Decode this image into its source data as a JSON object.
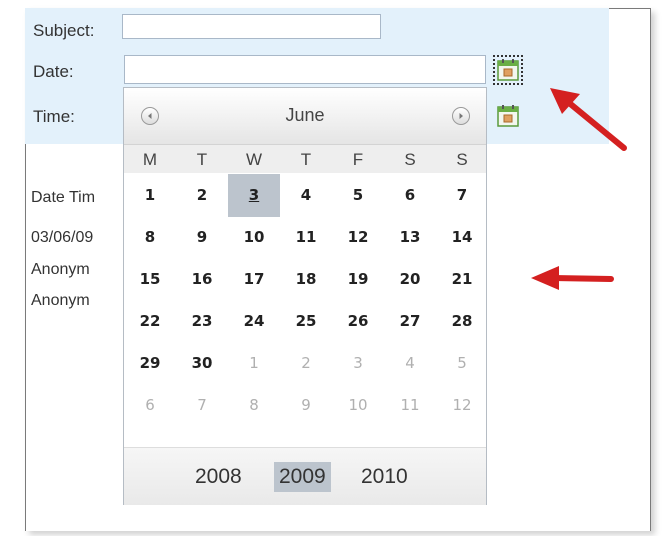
{
  "form": {
    "subject_label": "Subject:",
    "subject_value": "",
    "date_label": "Date:",
    "date_value": "",
    "time_label": "Time:"
  },
  "details": {
    "line1": "Date Tim",
    "line2": "03/06/09",
    "line3": "Anonym",
    "line4": "Anonym"
  },
  "calendar": {
    "month": "June",
    "prev_icon": "circle-chevron-left-icon",
    "next_icon": "circle-chevron-right-icon",
    "weekdays": [
      "M",
      "T",
      "W",
      "T",
      "F",
      "S",
      "S"
    ],
    "weeks": [
      [
        "1",
        "2",
        "3",
        "4",
        "5",
        "6",
        "7"
      ],
      [
        "8",
        "9",
        "10",
        "11",
        "12",
        "13",
        "14"
      ],
      [
        "15",
        "16",
        "17",
        "18",
        "19",
        "20",
        "21"
      ],
      [
        "22",
        "23",
        "24",
        "25",
        "26",
        "27",
        "28"
      ],
      [
        "29",
        "30",
        "1",
        "2",
        "3",
        "4",
        "5"
      ],
      [
        "6",
        "7",
        "8",
        "9",
        "10",
        "11",
        "12"
      ]
    ],
    "selected_day": "3",
    "years": [
      "2008",
      "2009",
      "2010"
    ],
    "selected_year": "2009"
  },
  "colors": {
    "form_background": "#e3f1fb",
    "selection": "#bcc4cd",
    "arrow": "#d42020",
    "calendar_icon": "#5a9a3c"
  }
}
